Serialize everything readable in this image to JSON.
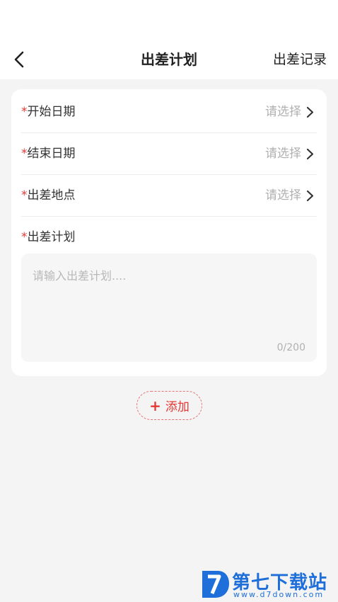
{
  "header": {
    "title": "出差计划",
    "right_link": "出差记录"
  },
  "form": {
    "required_mark": "*",
    "rows": [
      {
        "label": "开始日期",
        "value": "请选择"
      },
      {
        "label": "结束日期",
        "value": "请选择"
      },
      {
        "label": "出差地点",
        "value": "请选择"
      }
    ],
    "plan": {
      "label": "出差计划",
      "placeholder": "请输入出差计划....",
      "counter": "0/200"
    }
  },
  "add_button": {
    "icon": "+",
    "label": "添加"
  },
  "watermark": {
    "text": "第七下载站",
    "url": "www.d7down.com"
  },
  "colors": {
    "accent": "#e53935",
    "background": "#f4f4f4",
    "watermark": "#1e6fd9"
  }
}
